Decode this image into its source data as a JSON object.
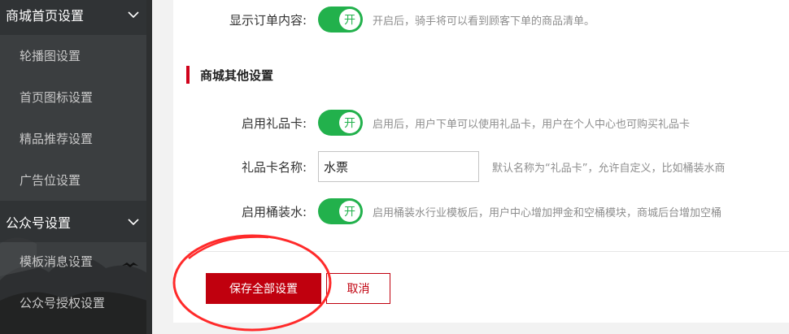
{
  "colors": {
    "sidebar_bg": "#3b3e40",
    "toggle_on": "#22b14c",
    "primary": "#c0000e",
    "section_accent": "#d0021b",
    "annotation": "#ff2a2a"
  },
  "sidebar": {
    "groups": [
      {
        "label": "商城首页设置",
        "icon": "chevron-down-icon",
        "items": [
          {
            "label": "轮播图设置"
          },
          {
            "label": "首页图标设置"
          },
          {
            "label": "精品推荐设置"
          },
          {
            "label": "广告位设置"
          }
        ]
      },
      {
        "label": "公众号设置",
        "icon": "chevron-down-icon",
        "items": [
          {
            "label": "模板消息设置"
          },
          {
            "label": "公众号授权设置"
          }
        ]
      }
    ]
  },
  "settings": {
    "show_order": {
      "label": "显示订单内容:",
      "toggle_text": "开",
      "hint": "开启后，骑手将可以看到顾客下单的商品清单。"
    },
    "other_section_title": "商城其他设置",
    "gift_card": {
      "label": "启用礼品卡:",
      "toggle_text": "开",
      "hint": "启用后，用户下单可以使用礼品卡，用户在个人中心也可购买礼品卡"
    },
    "gift_card_name": {
      "label": "礼品卡名称:",
      "value": "水票",
      "hint": "默认名称为“礼品卡”，允许自定义，比如桶装水商"
    },
    "bucket_water": {
      "label": "启用桶装水:",
      "toggle_text": "开",
      "hint": "启用桶装水行业模板后，用户中心增加押金和空桶模块，商城后台增加空桶"
    }
  },
  "actions": {
    "save_label": "保存全部设置",
    "cancel_label": "取消"
  }
}
